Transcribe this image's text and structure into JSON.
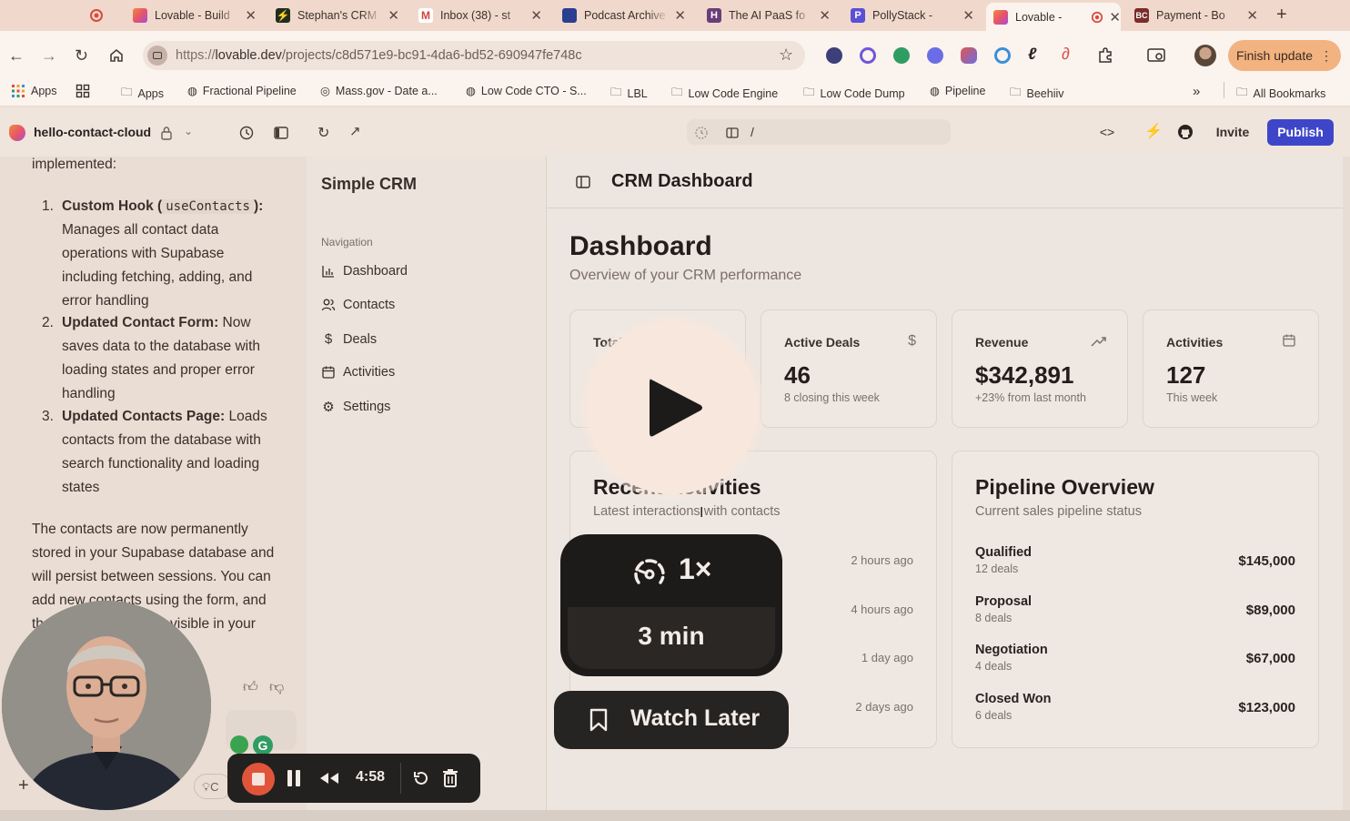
{
  "browser": {
    "tabs": [
      {
        "label": "",
        "color": "#d94a3b",
        "active": false
      },
      {
        "label": "Lovable - Build",
        "color": "#e8546a",
        "active": false
      },
      {
        "label": "Stephan's CRM",
        "color": "#1f2d1c",
        "active": false
      },
      {
        "label": "Inbox (38) - st",
        "color": "#d44638",
        "active": false
      },
      {
        "label": "Podcast Archive",
        "color": "#2a3f8f",
        "active": false
      },
      {
        "label": "The AI PaaS fo",
        "color": "#6a3d7a",
        "active": false
      },
      {
        "label": "PollyStack - ",
        "color": "#5b4fd6",
        "active": false
      },
      {
        "label": "Lovable - ",
        "color": "#e8546a",
        "active": true
      },
      {
        "label": "Payment - Bo",
        "color": "#7a2d2a",
        "active": false
      }
    ],
    "new_tab": "+",
    "url_prefix": "https://",
    "url_host": "lovable.dev",
    "url_path": "/projects/c8d571e9-bc91-4da6-bd52-690947fe748c",
    "finish_update": "Finish update",
    "bookmarks": [
      "Apps",
      "Apps",
      "Fractional Pipeline",
      "Mass.gov - Date a...",
      "Low Code CTO - S...",
      "LBL",
      "Low Code Engine",
      "Low Code Dump",
      "Pipeline",
      "Beehiiv"
    ],
    "all_bookmarks": "All Bookmarks",
    "overflow": "»"
  },
  "lovable": {
    "project_name": "hello-contact-cloud",
    "path": "/",
    "invite": "Invite",
    "publish": "Publish"
  },
  "chat": {
    "intro": "implemented:",
    "items": [
      {
        "num": "1.",
        "title": "Custom Hook (",
        "code": "useContacts",
        "title_end": "):",
        "body": "Manages all contact data operations with Supabase including fetching, adding, and error handling"
      },
      {
        "num": "2.",
        "title": "Updated Contact Form",
        "code": "",
        "title_end": ":",
        "body": "Now saves data to the database with loading states and proper error handling"
      },
      {
        "num": "3.",
        "title": "Updated Contacts Page",
        "code": "",
        "title_end": ":",
        "body": "Loads contacts from the database with search functionality and loading states"
      }
    ],
    "summary": "The contacts are now permanently stored in your Supabase database and will persist between sessions. You can add new contacts using the form, and they'll immediately be visible in your",
    "plus": "+",
    "input_hint": "C"
  },
  "app": {
    "brand": "Simple CRM",
    "nav_heading": "Navigation",
    "nav": [
      {
        "label": "Dashboard",
        "icon": "bar-chart-icon"
      },
      {
        "label": "Contacts",
        "icon": "users-icon"
      },
      {
        "label": "Deals",
        "icon": "dollar-icon"
      },
      {
        "label": "Activities",
        "icon": "calendar-icon"
      },
      {
        "label": "Settings",
        "icon": "gear-icon"
      }
    ],
    "header_title": "CRM Dashboard",
    "page_title": "Dashboard",
    "page_subtitle": "Overview of your CRM performance",
    "stats": [
      {
        "label": "Total",
        "value": "",
        "sub": "",
        "icon": "users-icon"
      },
      {
        "label": "Active Deals",
        "value": "46",
        "sub": "8 closing this week",
        "icon": "dollar-icon"
      },
      {
        "label": "Revenue",
        "value": "$342,891",
        "sub": "+23% from last month",
        "icon": "trending-up-icon"
      },
      {
        "label": "Activities",
        "value": "127",
        "sub": "This week",
        "icon": "calendar-icon"
      }
    ],
    "recent": {
      "title": "Recent Activities",
      "subtitle": "Latest interactions with contacts",
      "times": [
        "2 hours ago",
        "4 hours ago",
        "1 day ago",
        "2 days ago"
      ]
    },
    "pipeline": {
      "title": "Pipeline Overview",
      "subtitle": "Current sales pipeline status",
      "stages": [
        {
          "name": "Qualified",
          "deals": "12 deals",
          "amount": "$145,000"
        },
        {
          "name": "Proposal",
          "deals": "8 deals",
          "amount": "$89,000"
        },
        {
          "name": "Negotiation",
          "deals": "4 deals",
          "amount": "$67,000"
        },
        {
          "name": "Closed Won",
          "deals": "6 deals",
          "amount": "$123,000"
        }
      ]
    }
  },
  "video_overlay": {
    "speed": "1×",
    "duration": "3 min",
    "watch_later": "Watch Later"
  },
  "recorder": {
    "time": "4:58"
  },
  "colors": {
    "publish": "#3d46c8",
    "record": "#e0553a",
    "accent_green": "#3aa34f"
  }
}
